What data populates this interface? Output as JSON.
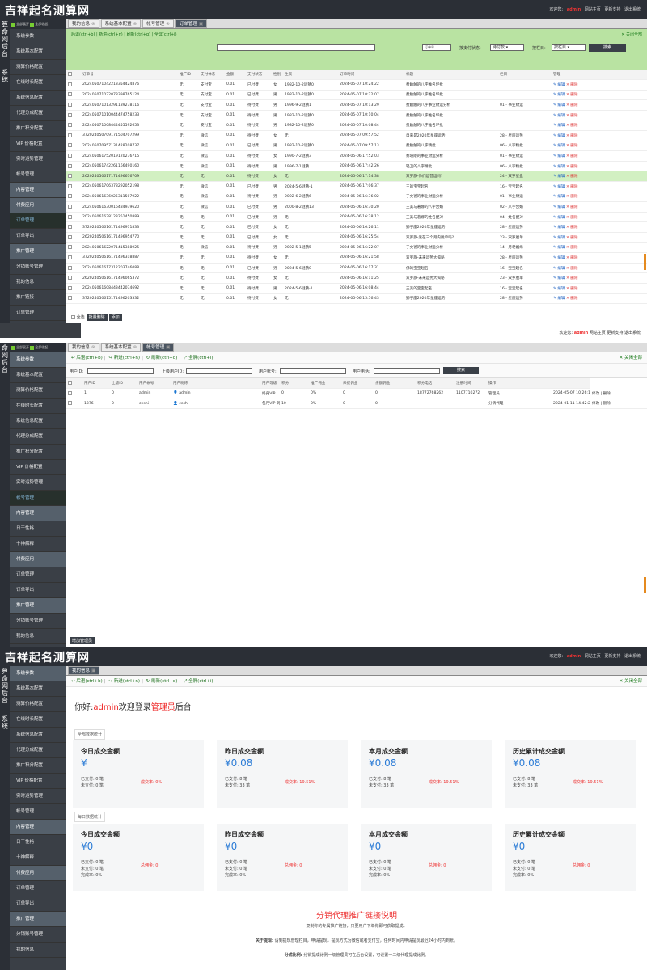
{
  "app": {
    "logo": "吉祥起名测算网",
    "user_label": "欢迎您:",
    "user": "admin",
    "links": [
      "网站主页",
      "更新支持",
      "退出系统"
    ]
  },
  "vertical_label": [
    "算",
    "命",
    "网",
    "后",
    "台"
  ],
  "vertical_label_short": [
    "系",
    "统"
  ],
  "sidebar_top": [
    "全部展开",
    "全部收起"
  ],
  "p1": {
    "sidebar": [
      {
        "t": "系统参数",
        "g": false
      },
      {
        "t": "系统基本配置",
        "g": false
      },
      {
        "t": "测算价格配置",
        "g": false
      },
      {
        "t": "在线时长配置",
        "g": false
      },
      {
        "t": "系统信息配置",
        "g": false
      },
      {
        "t": "代理分成配置",
        "g": false
      },
      {
        "t": "推广积分配置",
        "g": false
      },
      {
        "t": "VIP 价格配置",
        "g": false
      },
      {
        "t": "实时运势管理",
        "g": false
      },
      {
        "t": "帐号管理",
        "g": false
      },
      {
        "t": "内容管理",
        "g": true
      },
      {
        "t": "付费应用",
        "g": true
      },
      {
        "t": "订单管理",
        "g": false,
        "a": true
      },
      {
        "t": "订单导出",
        "g": false
      },
      {
        "t": "推广管理",
        "g": true
      },
      {
        "t": "分销账号管理",
        "g": false
      },
      {
        "t": "我的信息",
        "g": false
      },
      {
        "t": "推广链接",
        "g": false
      },
      {
        "t": "订单管理",
        "g": false
      }
    ],
    "tabs": [
      "我的信息",
      "系统基本配置",
      "帐号管理",
      "订单管理"
    ],
    "toolbar": [
      "后退(ctrl+b)",
      "新进(ctrl+n)",
      "刷新(ctrl+q)",
      "全屏(ctrl+i)"
    ],
    "close_all": "关闭全部",
    "filter": {
      "pay_status_label": "按支付状态:",
      "pay_status": "待付款",
      "col_label": "按栏目:",
      "col_value": "按栏目",
      "search": "搜索",
      "order_value": "订单号"
    },
    "headers": [
      "",
      "订单号",
      "推广ID",
      "支付体系",
      "金额",
      "支付状态",
      "性别",
      "生辰",
      "订单时间",
      "标题",
      "栏目",
      "管理"
    ],
    "rows": [
      [
        "202405071042213354424876",
        "无",
        "支付宝",
        "0.01",
        "已付费",
        "女",
        "1982-10-2谜猜0",
        "2024-05-07 10:24:22",
        "费触触的八字推名坪批",
        "",
        ""
      ],
      [
        "202405071022078398765124",
        "无",
        "支付宝",
        "0.01",
        "已付费",
        "男",
        "1982-10-2谜猜0",
        "2024-05-07 10:22:07",
        "费触触的八字推名坪批",
        "",
        ""
      ],
      [
        "202405071013291189278116",
        "无",
        "支付宝",
        "0.01",
        "待付费",
        "男",
        "1996-9-2谜猜1",
        "2024-05-07 10:13:29",
        "费触触的八字事业财运分析",
        "01 - 事业财运",
        ""
      ],
      [
        "202405071010044474758233",
        "无",
        "支付宝",
        "0.01",
        "待付费",
        "男",
        "1982-10-2谜猜0",
        "2024-05-07 10:10:04",
        "费触触的八字推名坪批",
        "",
        ""
      ],
      [
        "202405071008444455592653",
        "无",
        "支付宝",
        "0.01",
        "待付费",
        "男",
        "1982-10-2谜猜0",
        "2024-05-07 10:08:44",
        "费触触的八字推名坪批",
        "",
        ""
      ],
      [
        "372024050709171504707299",
        "无",
        "微信",
        "0.01",
        "待付费",
        "女",
        "无",
        "2024-05-07 09:57:52",
        "自来是2020年星座运势",
        "28 - 星座运势",
        ""
      ],
      [
        "202405070957131428208737",
        "无",
        "微信",
        "0.01",
        "已付费",
        "男",
        "1982-10-2谜猜0",
        "2024-05-07 09:57:13",
        "费触触的八字精批",
        "06 - 八字精批",
        ""
      ],
      [
        "202405061752019120276715",
        "无",
        "微信",
        "0.01",
        "待付费",
        "女",
        "1990-7-2谜猜3",
        "2024-05-06 17:52:03",
        "秦珊刚的事业财运分析",
        "01 - 事业财运",
        ""
      ],
      [
        "202405061742261166490160",
        "无",
        "微信",
        "0.01",
        "待付费",
        "男",
        "1996-7-1谜猜",
        "2024-05-06 17:42:26",
        "轻卫的八字精批",
        "06 - 八字精批",
        ""
      ],
      [
        "262024050617171496676709",
        "无",
        "无",
        "0.01",
        "待付费",
        "女",
        "无",
        "2024-05-06 17:14:38",
        "双罗旗-你们运营运吗?",
        "24 - 双罗星盘",
        ""
      ],
      [
        "202405061706378292052198",
        "无",
        "微信",
        "0.01",
        "已付费",
        "男",
        "2024-5-6谜猜-1",
        "2024-05-06 17:06:37",
        "王的宝宝起名",
        "16 - 宝宝起名",
        ""
      ],
      [
        "202405061636025311507922",
        "无",
        "微信",
        "0.01",
        "待付费",
        "男",
        "2002-6-2谜猜6",
        "2024-05-06 16:36:02",
        "于文德的事业财运分析",
        "01 - 事业财运",
        ""
      ],
      [
        "202405061630016484939620",
        "无",
        "微信",
        "0.01",
        "已付费",
        "男",
        "2000-8-2谜猜13",
        "2024-05-06 16:30:20",
        "王美与著娜的八字合婚",
        "02 - 八字合婚",
        ""
      ],
      [
        "202405061628123251450889",
        "无",
        "无",
        "0.01",
        "已付费",
        "男",
        "无",
        "2024-05-06 16:28:12",
        "王美与著娜的姓名配对",
        "04 - 姓名配对",
        ""
      ],
      [
        "372024050616171496971833",
        "无",
        "无",
        "0.01",
        "已付费",
        "女",
        "无",
        "2024-05-06 16:26:11",
        "狮子座2020年星座运势",
        "28 - 星座运势",
        ""
      ],
      [
        "262024050616171496954770",
        "无",
        "无",
        "0.01",
        "已付费",
        "女",
        "无",
        "2024-05-06 16:25:54",
        "双罗旗-爱在三个月内脱单吗?",
        "23 - 双罗脱单",
        ""
      ],
      [
        "202405061622071415388925",
        "无",
        "微信",
        "0.01",
        "待付费",
        "男",
        "2002-5-1谜猜5",
        "2024-05-06 16:22:07",
        "于文德的事业财运分析",
        "14 - 月老姻缘",
        ""
      ],
      [
        "372024050616171496318887",
        "无",
        "无",
        "0.01",
        "待付费",
        "女",
        "无",
        "2024-05-06 16:21:58",
        "双罗旗-未来运势大揭秘",
        "28 - 星座运势",
        ""
      ],
      [
        "202405061617312203746088",
        "无",
        "无",
        "0.01",
        "已付费",
        "男",
        "2024-5-6谜猜0",
        "2024-05-06 16:17:31",
        "佛的宝宝起名",
        "16 - 宝宝起名",
        ""
      ],
      [
        "262024050616171496065372",
        "无",
        "无",
        "0.01",
        "待付费",
        "女",
        "无",
        "2024-05-06 16:11:25",
        "双罗旗-未来运势大揭秘",
        "23 - 双罗脱单",
        ""
      ],
      [
        "202405061608443442074692",
        "无",
        "无",
        "0.01",
        "待付费",
        "男",
        "2024-5-6谜猜-1",
        "2024-05-06 16:08:44",
        "王美的宝宝起名",
        "16 - 宝宝起名",
        ""
      ],
      [
        "372024050615171496203332",
        "无",
        "无",
        "0.01",
        "待付费",
        "女",
        "无",
        "2024-05-06 15:56:43",
        "狮子座2020年星座运势",
        "28 - 星座运势",
        ""
      ]
    ],
    "row_ops": [
      "编辑",
      "删除"
    ],
    "footer": [
      "全选",
      "批量删除",
      "添加"
    ]
  },
  "p2": {
    "sidebar": [
      {
        "t": "系统参数",
        "g": true
      },
      {
        "t": "系统基本配置",
        "g": false
      },
      {
        "t": "测算价格配置",
        "g": false
      },
      {
        "t": "在线时长配置",
        "g": false
      },
      {
        "t": "系统信息配置",
        "g": false
      },
      {
        "t": "代理分成配置",
        "g": false
      },
      {
        "t": "推广积分配置",
        "g": false
      },
      {
        "t": "VIP 价格配置",
        "g": false
      },
      {
        "t": "实时运势管理",
        "g": false
      },
      {
        "t": "帐号管理",
        "g": false,
        "a": true
      },
      {
        "t": "内容管理",
        "g": true
      },
      {
        "t": "日干性格",
        "g": false
      },
      {
        "t": "十神解释",
        "g": false
      },
      {
        "t": "付费应用",
        "g": true
      },
      {
        "t": "订单管理",
        "g": false
      },
      {
        "t": "订单导出",
        "g": false
      },
      {
        "t": "推广管理",
        "g": true
      },
      {
        "t": "分销账号管理",
        "g": false
      },
      {
        "t": "我的信息",
        "g": false
      }
    ],
    "tabs": [
      "我的信息",
      "系统基本配置",
      "帐号管理"
    ],
    "toolbar": [
      "后退(ctrl+b)",
      "新进(ctrl+n)",
      "刷新(ctrl+q)",
      "全屏(ctrl+i)"
    ],
    "close_all": "关闭全部",
    "filter": [
      "用户ID:",
      "上级用户ID:",
      "用户帐号:",
      "用户电话:"
    ],
    "search": "搜索",
    "headers": [
      "",
      "用户ID",
      "上级ID",
      "用户帐号",
      "用户昵称",
      "用户等级",
      "积分",
      "推广佣金",
      "未提佣金",
      "余额佣金",
      "积分电话",
      "注册时间",
      "操作"
    ],
    "rows": [
      [
        "1",
        "0",
        "admin",
        "admin",
        "终身VIP",
        "0",
        "0%",
        "0",
        "0",
        "18772768262",
        "1107710272",
        "管理员",
        "2024-05-07 10:26:11"
      ],
      [
        "1376",
        "0",
        "ceshi",
        "ceshi",
        "包月VIP 到期时间: 2024-02-11",
        "10",
        "0%",
        "0",
        "0",
        "",
        "",
        "分销代理",
        "2024-01-11 14:42:26"
      ]
    ],
    "row_ops": [
      "修改",
      "删除"
    ],
    "footer": "增加管理员"
  },
  "p3": {
    "sidebar": [
      {
        "t": "系统参数",
        "g": true
      },
      {
        "t": "系统基本配置",
        "g": false
      },
      {
        "t": "测算价格配置",
        "g": false
      },
      {
        "t": "在线时长配置",
        "g": false
      },
      {
        "t": "系统信息配置",
        "g": false
      },
      {
        "t": "代理分成配置",
        "g": false
      },
      {
        "t": "推广积分配置",
        "g": false
      },
      {
        "t": "VIP 价格配置",
        "g": false
      },
      {
        "t": "实时运势管理",
        "g": false
      },
      {
        "t": "帐号管理",
        "g": false
      },
      {
        "t": "内容管理",
        "g": true
      },
      {
        "t": "日干性格",
        "g": false
      },
      {
        "t": "十神解释",
        "g": false
      },
      {
        "t": "付费应用",
        "g": true
      },
      {
        "t": "订单管理",
        "g": false
      },
      {
        "t": "订单导出",
        "g": false
      },
      {
        "t": "推广管理",
        "g": true
      },
      {
        "t": "分销账号管理",
        "g": false
      },
      {
        "t": "我的信息",
        "g": false
      }
    ],
    "tabs": [
      "我的信息"
    ],
    "toolbar": [
      "后退(ctrl+b)",
      "新进(ctrl+n)",
      "刷新(ctrl+q)",
      "全屏(ctrl+i)"
    ],
    "close_all": "关闭全部",
    "welcome": {
      "pre": "你好:",
      "user": "admin",
      "mid": "欢迎登录",
      "role": "管理员",
      "post": "后台"
    },
    "sec1": "全部数据统计",
    "sec2": "每日数据统计",
    "cards1": [
      {
        "title": "今日成交金额",
        "value": "¥",
        "l1": "已支付: 0 笔",
        "l2": "未支付: 0 笔",
        "r": "成交率: 0%"
      },
      {
        "title": "昨日成交金额",
        "value": "¥0.08",
        "l1": "已支付: 8 笔",
        "l2": "未支付: 33 笔",
        "r": "成交率: 19.51%"
      },
      {
        "title": "本月成交金额",
        "value": "¥0.08",
        "l1": "已支付: 8 笔",
        "l2": "未支付: 33 笔",
        "r": "成交率: 19.51%"
      },
      {
        "title": "历史累计成交金额",
        "value": "¥0.08",
        "l1": "已支付: 8 笔",
        "l2": "未支付: 33 笔",
        "r": "成交率: 19.51%"
      }
    ],
    "cards2": [
      {
        "title": "今日成交金额",
        "value": "¥0",
        "l1": "已支付: 0 笔",
        "l2": "未支付: 0 笔",
        "l3": "完成率: 0%",
        "r": "总佣金: 0"
      },
      {
        "title": "昨日成交金额",
        "value": "¥0",
        "l1": "已支付: 0 笔",
        "l2": "未支付: 0 笔",
        "l3": "完成率: 0%",
        "r": "总佣金: 0"
      },
      {
        "title": "本月成交金额",
        "value": "¥0",
        "l1": "已支付: 0 笔",
        "l2": "未支付: 0 笔",
        "l3": "完成率: 0%",
        "r": "总佣金: 0"
      },
      {
        "title": "历史累计成交金额",
        "value": "¥0",
        "l1": "已支付: 0 笔",
        "l2": "未支付: 0 笔",
        "l3": "完成率: 0%",
        "r": "总佣金: 0"
      }
    ],
    "promo": {
      "title": "分销代理推广链接说明",
      "l1": "复制你的专属推广链接，只要用户下单你即可获取提成。",
      "l2k": "关于提现:",
      "l2": "请到提现管理栏目，申请提现，提现方式为微信或者支付宝，任何时间内申请提现最迟24小时内到账。",
      "l3k": "分成比例:",
      "l3": "分销提成比例一级管理员可在后台设置，可设置一二级代理提成比例。"
    }
  }
}
